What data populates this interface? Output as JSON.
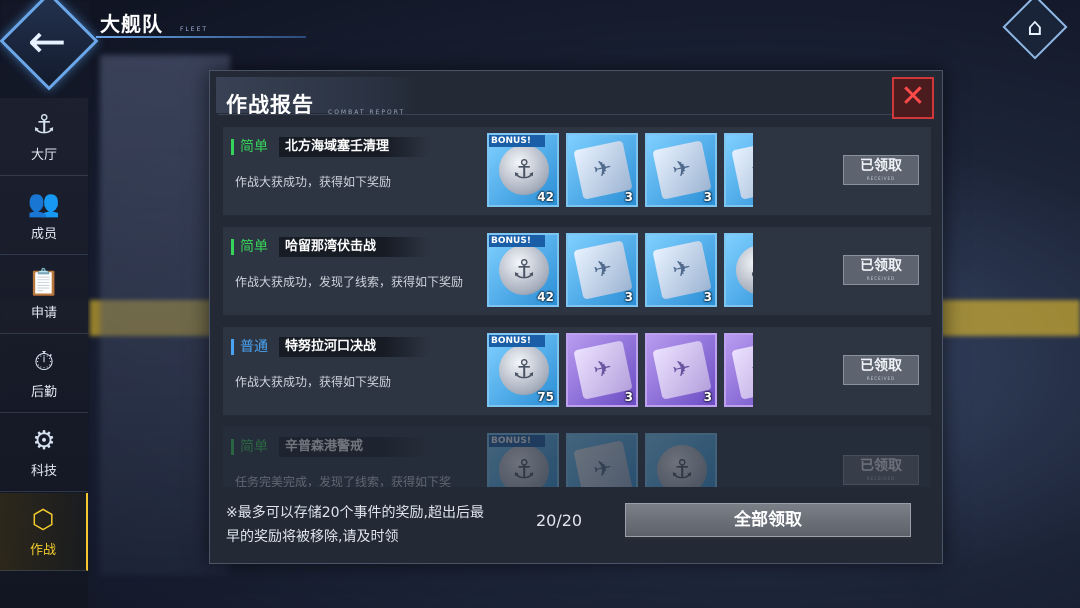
{
  "header": {
    "title": "大舰队",
    "subtitle": "FLEET",
    "back_icon": "←",
    "home_icon": "⌂"
  },
  "sidebar": {
    "items": [
      {
        "label": "大厅",
        "icon": "⚓",
        "active": false
      },
      {
        "label": "成员",
        "icon": "👥",
        "active": false
      },
      {
        "label": "申请",
        "icon": "📋",
        "active": false
      },
      {
        "label": "后勤",
        "icon": "⏱",
        "active": false
      },
      {
        "label": "科技",
        "icon": "⚙",
        "active": false
      },
      {
        "label": "作战",
        "icon": "⬡",
        "active": true
      }
    ]
  },
  "dialog": {
    "title": "作战报告",
    "subtitle": "COMBAT REPORT",
    "close_icon": "✕",
    "battles": [
      {
        "difficulty": "简单",
        "difficulty_type": "easy",
        "name": "北方海域塞壬清理",
        "desc": "作战大获成功，获得如下奖励",
        "rewards": [
          {
            "kind": "coin",
            "bonus": "BONUS!",
            "qty": "42"
          },
          {
            "kind": "book",
            "qty": "3"
          },
          {
            "kind": "book",
            "qty": "3"
          },
          {
            "kind": "book",
            "qty": ""
          }
        ],
        "status": "已领取",
        "status_sub": "RECEIVED"
      },
      {
        "difficulty": "简单",
        "difficulty_type": "easy",
        "name": "哈留那湾伏击战",
        "desc": "作战大获成功，发现了线索，获得如下奖励",
        "rewards": [
          {
            "kind": "coin",
            "bonus": "BONUS!",
            "qty": "42"
          },
          {
            "kind": "book",
            "qty": "3"
          },
          {
            "kind": "book",
            "qty": "3"
          },
          {
            "kind": "coin",
            "qty": ""
          }
        ],
        "status": "已领取",
        "status_sub": "RECEIVED"
      },
      {
        "difficulty": "普通",
        "difficulty_type": "normal",
        "name": "特努拉河口决战",
        "desc": "作战大获成功，获得如下奖励",
        "rewards": [
          {
            "kind": "coin",
            "bonus": "BONUS!",
            "qty": "75"
          },
          {
            "kind": "book",
            "color": "purple",
            "qty": "3"
          },
          {
            "kind": "book",
            "color": "purple",
            "qty": "3"
          },
          {
            "kind": "book",
            "color": "purple",
            "qty": ""
          }
        ],
        "status": "已领取",
        "status_sub": "RECEIVED"
      },
      {
        "difficulty": "简单",
        "difficulty_type": "easy",
        "name": "辛普森港警戒",
        "desc": "任务完美完成，发现了线索，获得如下奖",
        "rewards": [
          {
            "kind": "coin",
            "bonus": "BONUS!",
            "qty": ""
          },
          {
            "kind": "book",
            "qty": ""
          },
          {
            "kind": "coin",
            "qty": ""
          }
        ],
        "status": "已领取",
        "status_sub": "RECEIVED"
      }
    ],
    "note": "※最多可以存储20个事件的奖励,超出后最早的奖励将被移除,请及时领",
    "count": "20/20",
    "claim_all": "全部领取"
  }
}
